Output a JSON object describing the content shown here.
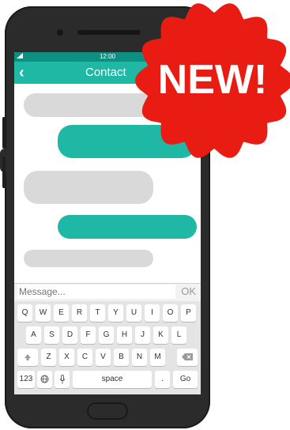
{
  "status": {
    "time": "12:00",
    "signal_icon": "signal-icon"
  },
  "header": {
    "back_icon": "‹",
    "title": "Contact"
  },
  "input": {
    "placeholder": "Message...",
    "ok_label": "OK"
  },
  "keyboard": {
    "row1": [
      "Q",
      "W",
      "E",
      "R",
      "T",
      "Y",
      "U",
      "I",
      "O",
      "P"
    ],
    "row2": [
      "A",
      "S",
      "D",
      "F",
      "G",
      "H",
      "J",
      "K",
      "L"
    ],
    "row3_letters": [
      "Z",
      "X",
      "C",
      "V",
      "B",
      "N",
      "M"
    ],
    "row4": {
      "num": "123",
      "space": "space",
      "period": ".",
      "go": "Go"
    }
  },
  "badge": {
    "text": "NEW!",
    "color": "#e81c12"
  },
  "colors": {
    "accent": "#1fb8a4",
    "status_bar": "#0f8f81",
    "incoming_bubble": "#d9d9d9"
  }
}
